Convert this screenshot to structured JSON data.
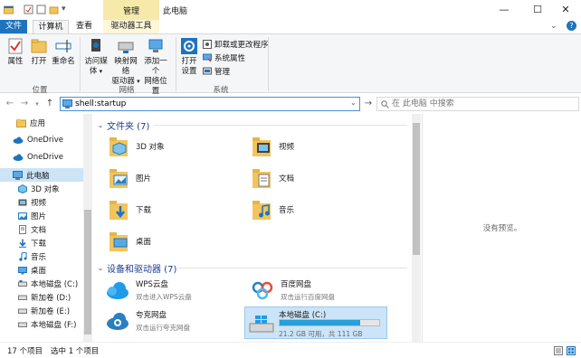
{
  "title_bar": {
    "context_title": "管理",
    "window_title": "此电脑",
    "minimize": "—",
    "maximize": "☐",
    "close": "✕"
  },
  "ribbon_tabs": {
    "file": "文件",
    "computer": "计算机",
    "view": "查看",
    "drive_tools": "驱动器工具"
  },
  "ribbon": {
    "location": {
      "label": "位置",
      "properties": "属性",
      "open": "打开",
      "rename": "重命名"
    },
    "network": {
      "label": "网络",
      "access_media": "访问媒体",
      "map_drive_line1": "映射网络",
      "map_drive_line2": "驱动器",
      "add_location_line1": "添加一个",
      "add_location_line2": "网络位置"
    },
    "system": {
      "label": "系统",
      "open_settings_line1": "打开",
      "open_settings_line2": "设置",
      "uninstall": "卸载或更改程序",
      "system_properties": "系统属性",
      "manage": "管理"
    }
  },
  "address_bar": {
    "path": "shell:startup",
    "search_placeholder": "在 此电脑 中搜索"
  },
  "nav_pane": {
    "items": [
      {
        "label": "应用",
        "icon": "folder-icon"
      },
      {
        "label": "OneDrive",
        "icon": "cloud-icon"
      },
      {
        "label": "OneDrive",
        "icon": "cloud-icon"
      },
      {
        "label": "此电脑",
        "icon": "computer-icon"
      },
      {
        "label": "3D 对象",
        "icon": "cube-icon"
      },
      {
        "label": "视频",
        "icon": "video-icon"
      },
      {
        "label": "图片",
        "icon": "picture-icon"
      },
      {
        "label": "文档",
        "icon": "document-icon"
      },
      {
        "label": "下载",
        "icon": "download-icon"
      },
      {
        "label": "音乐",
        "icon": "music-icon"
      },
      {
        "label": "桌面",
        "icon": "desktop-icon"
      },
      {
        "label": "本地磁盘 (C:)",
        "icon": "drive-icon"
      },
      {
        "label": "新加卷 (D:)",
        "icon": "drive-icon"
      },
      {
        "label": "新加卷 (E:)",
        "icon": "drive-icon"
      },
      {
        "label": "本地磁盘 (F:)",
        "icon": "drive-icon"
      }
    ]
  },
  "content": {
    "folders_header": "文件夹 (7)",
    "folders": [
      {
        "label": "3D 对象",
        "icon": "cube-folder-icon"
      },
      {
        "label": "视频",
        "icon": "video-folder-icon"
      },
      {
        "label": "图片",
        "icon": "picture-folder-icon"
      },
      {
        "label": "文档",
        "icon": "document-folder-icon"
      },
      {
        "label": "下载",
        "icon": "download-folder-icon"
      },
      {
        "label": "音乐",
        "icon": "music-folder-icon"
      },
      {
        "label": "桌面",
        "icon": "desktop-folder-icon"
      }
    ],
    "devices_header": "设备和驱动器 (7)",
    "devices": [
      {
        "name": "WPS云盘",
        "sub": "双击进入WPS云盘",
        "icon": "wps-cloud-icon"
      },
      {
        "name": "百度网盘",
        "sub": "双击运行百度网盘",
        "icon": "baidu-netdisk-icon"
      },
      {
        "name": "夸克网盘",
        "sub": "双击运行夸克网盘",
        "icon": "quark-netdisk-icon"
      },
      {
        "name": "本地磁盘 (C:)",
        "sub": "21.2 GB 可用，共 111 GB",
        "icon": "windows-drive-icon",
        "usage_fraction": 0.81
      }
    ]
  },
  "preview": {
    "empty_text": "没有预览。"
  },
  "status": {
    "item_count": "17 个项目",
    "selected": "选中 1 个项目"
  },
  "colors": {
    "accent": "#1e73be",
    "selection": "#cce4f7",
    "context_tab": "#f6e9a9",
    "folder": "#f2c55c",
    "drive_bar": "#26a0da"
  }
}
